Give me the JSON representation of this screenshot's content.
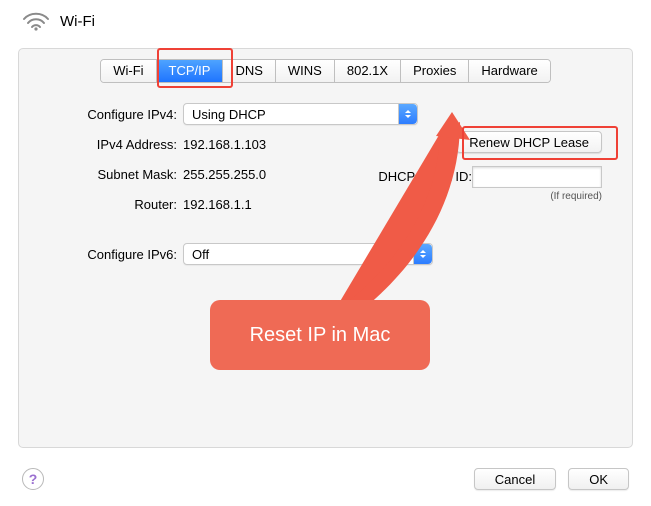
{
  "title": "Wi-Fi",
  "tabs": [
    "Wi-Fi",
    "TCP/IP",
    "DNS",
    "WINS",
    "802.1X",
    "Proxies",
    "Hardware"
  ],
  "tabs_selected_index": 1,
  "ipv4": {
    "configure_label": "Configure IPv4:",
    "configure_value": "Using DHCP",
    "address_label": "IPv4 Address:",
    "address_value": "192.168.1.103",
    "subnet_label": "Subnet Mask:",
    "subnet_value": "255.255.255.0",
    "router_label": "Router:",
    "router_value": "192.168.1.1"
  },
  "dhcp": {
    "renew_label": "Renew DHCP Lease",
    "client_id_label": "DHCP Client ID:",
    "client_id_value": "",
    "if_required": "(If required)"
  },
  "ipv6": {
    "configure_label": "Configure IPv6:",
    "configure_value": "Off"
  },
  "footer": {
    "help": "?",
    "cancel": "Cancel",
    "ok": "OK"
  },
  "annotation": {
    "callout_text": "Reset IP in Mac"
  }
}
